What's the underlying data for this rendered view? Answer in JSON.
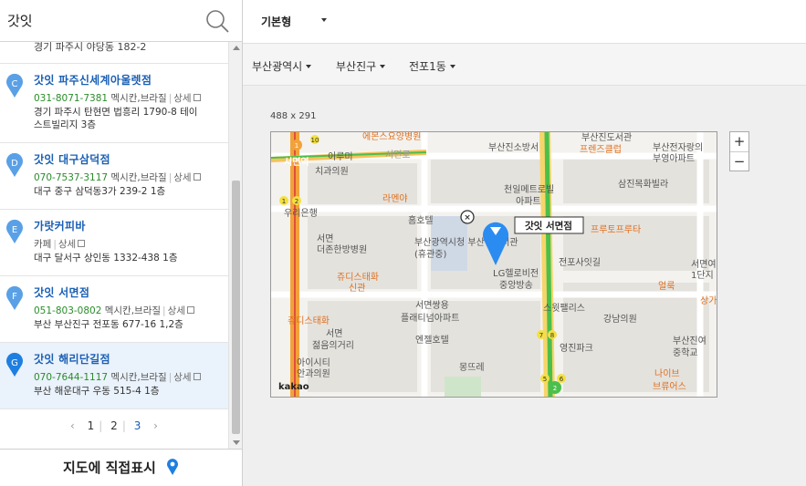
{
  "search": {
    "value": "갓잇"
  },
  "list": {
    "partial_address": "경기 파주시 야당동 182-2",
    "items": [
      {
        "marker": "C",
        "name": "갓잇 파주신세계아울렛점",
        "phone": "031-8071-7381",
        "category": "멕시칸,브라질",
        "detail": "상세",
        "address_line1": "경기 파주시 탄현면 법흥리 1790-8 테이",
        "address_line2": "스트빌리지 3층"
      },
      {
        "marker": "D",
        "name": "갓잇 대구삼덕점",
        "phone": "070-7537-3117",
        "category": "멕시칸,브라질",
        "detail": "상세",
        "address_line1": "대구 중구 삼덕동3가 239-2 1층"
      },
      {
        "marker": "E",
        "name": "가랏커피바",
        "phone": "",
        "category": "카페",
        "detail": "상세",
        "address_line1": "대구 달서구 상인동 1332-438 1층"
      },
      {
        "marker": "F",
        "name": "갓잇 서면점",
        "phone": "051-803-0802",
        "category": "멕시칸,브라질",
        "detail": "상세",
        "address_line1": "부산 부산진구 전포동 677-16 1,2층"
      },
      {
        "marker": "G",
        "name": "갓잇 해리단길점",
        "phone": "070-7644-1117",
        "category": "멕시칸,브라질",
        "detail": "상세",
        "address_line1": "부산 해운대구 우동 515-4 1층"
      }
    ]
  },
  "pager": {
    "pages": [
      "1",
      "2",
      "3"
    ],
    "current": "3"
  },
  "bottom_button": "지도에 직접표시",
  "map_style": "기본형",
  "breadcrumbs": [
    "부산광역시",
    "부산진구",
    "전포1동"
  ],
  "map_size_label": "488 x 291",
  "map": {
    "marker_label": "갓잇 서면점",
    "places": [
      "에몬스요양병원",
      "부산진소방서",
      "프렌즈클럽",
      "부산진도서관",
      "부산전자랑의",
      "부영아파트",
      "서면역",
      "서면로",
      "이루미",
      "치과의원",
      "라멘야",
      "천일메트로빌",
      "아파트",
      "삼진목화빌라",
      "우리은행",
      "홈호텔",
      "부산광역시청 부산진구서관",
      "(휴관중)",
      "프루토프루타",
      "서면",
      "더존한방병원",
      "LG헬로비전",
      "중앙방송",
      "전포사잇길",
      "서면여",
      "1단지",
      "쥬디스태화",
      "신관",
      "얼룩",
      "상가",
      "서면쌍용",
      "플래티넘아파트",
      "스윗팰리스",
      "강남의원",
      "쥬디스태화",
      "서면",
      "젊음의거리",
      "엔젤호텔",
      "영진파크",
      "부산진여",
      "중학교",
      "아이시티",
      "안과의원",
      "몽뜨레",
      "나이브",
      "브류어스",
      "kakao"
    ],
    "colors": {
      "road_main": "#f0a030",
      "road_green": "#4bbf4b",
      "marker": "#2a8cf0",
      "place_orange": "#e07020"
    }
  }
}
